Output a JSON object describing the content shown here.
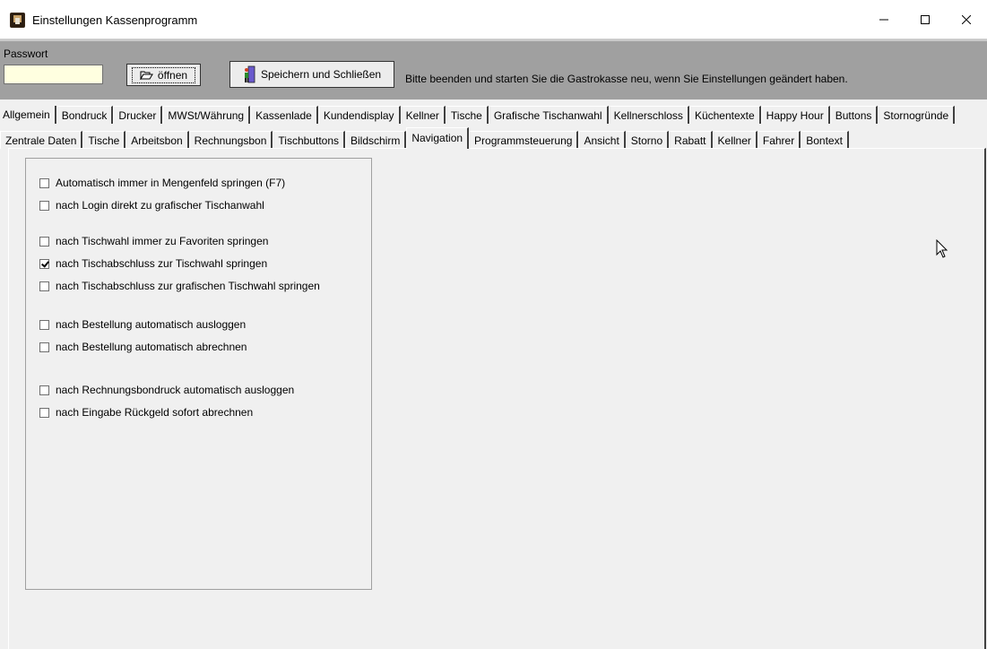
{
  "window": {
    "title": "Einstellungen Kassenprogramm",
    "controls": {
      "minimize": "—",
      "maximize": "☐",
      "close": "✕"
    }
  },
  "toolbar": {
    "password_label": "Passwort",
    "password_value": "",
    "open_label": "öffnen",
    "save_label": "Speichern und Schließen",
    "info_text": "Bitte beenden und starten Sie die Gastrokasse neu, wenn Sie Einstellungen geändert haben."
  },
  "tabs_top": [
    "Allgemein",
    "Bondruck",
    "Drucker",
    "MWSt/Währung",
    "Kassenlade",
    "Kundendisplay",
    "Kellner",
    "Tische",
    "Grafische Tischanwahl",
    "Kellnerschloss",
    "Küchentexte",
    "Happy Hour",
    "Buttons",
    "Stornogründe"
  ],
  "tabs_top_active": "Allgemein",
  "tabs_bottom": [
    "Zentrale Daten",
    "Tische",
    "Arbeitsbon",
    "Rechnungsbon",
    "Tischbuttons",
    "Bildschirm",
    "Navigation",
    "Programmsteuerung",
    "Ansicht",
    "Storno",
    "Rabatt",
    "Kellner",
    "Fahrer",
    "Bontext"
  ],
  "tabs_bottom_active": "Navigation",
  "options": [
    {
      "label": "Automatisch immer in Mengenfeld springen (F7)",
      "checked": false
    },
    {
      "label": "nach Login direkt zu grafischer Tischanwahl",
      "checked": false
    },
    {
      "label": "nach Tischwahl immer zu Favoriten springen",
      "checked": false
    },
    {
      "label": "nach Tischabschluss zur Tischwahl springen",
      "checked": true
    },
    {
      "label": "nach Tischabschluss zur grafischen Tischwahl springen",
      "checked": false
    },
    {
      "label": "nach Bestellung automatisch ausloggen",
      "checked": false
    },
    {
      "label": "nach Bestellung automatisch abrechnen",
      "checked": false
    },
    {
      "label": "nach Rechnungsbondruck automatisch ausloggen",
      "checked": false
    },
    {
      "label": "nach Eingabe Rückgeld sofort abrechnen",
      "checked": false
    }
  ],
  "colors": {
    "toolbar_bg": "#a0a0a0",
    "password_bg": "#ffffe0",
    "window_bg": "#f0f0f0"
  },
  "icons": {
    "app": "app-icon",
    "open": "folder-open-icon",
    "save": "exit-door-icon",
    "pointer": "mouse-pointer-icon"
  }
}
